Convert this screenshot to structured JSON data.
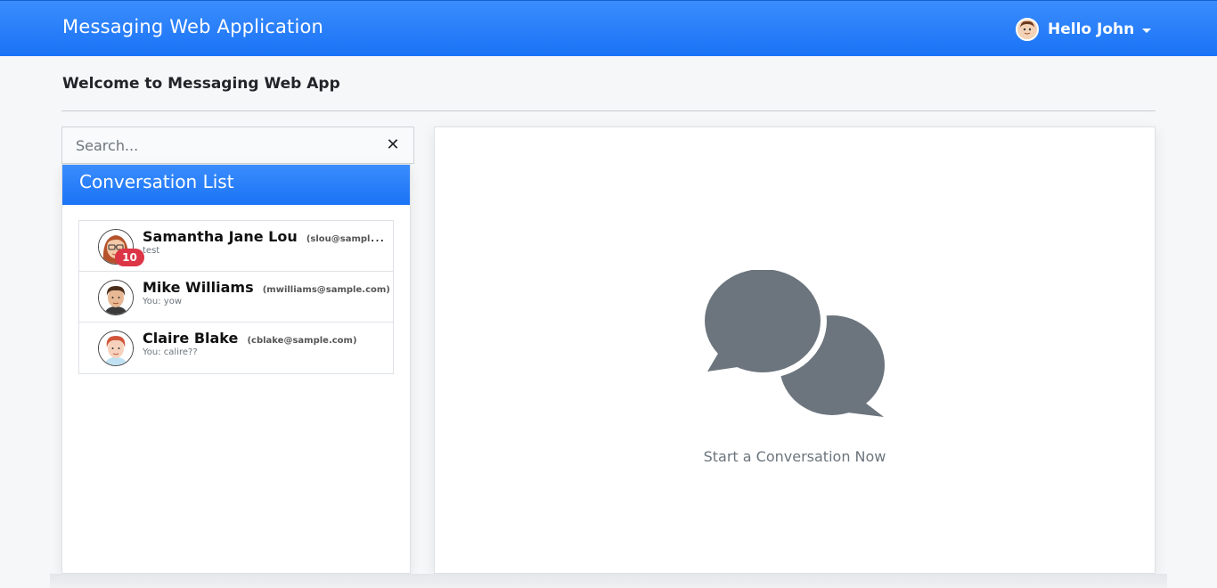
{
  "navbar": {
    "brand": "Messaging Web Application",
    "user_greeting": "Hello John"
  },
  "welcome_text": "Welcome to Messaging Web App",
  "search": {
    "placeholder": "Search...",
    "clear_symbol": "✕"
  },
  "conversation_list": {
    "title": "Conversation List",
    "items": [
      {
        "name": "Samantha Jane Lou",
        "email": "(slou@sample.com)",
        "preview": "test",
        "unread": "10",
        "avatar": "woman-glasses-avatar"
      },
      {
        "name": "Mike Williams",
        "email": "(mwilliams@sample.com)",
        "preview": "You: yow",
        "unread": "",
        "avatar": "man-avatar"
      },
      {
        "name": "Claire Blake",
        "email": "(cblake@sample.com)",
        "preview": "You: calire??",
        "unread": "",
        "avatar": "woman-redhair-avatar"
      }
    ]
  },
  "main": {
    "empty_icon": "chat-bubbles-icon",
    "empty_message": "Start a Conversation Now"
  },
  "colors": {
    "primary": "#1a73f6",
    "badge": "#dc3545",
    "icon_gray": "#6c757d"
  }
}
